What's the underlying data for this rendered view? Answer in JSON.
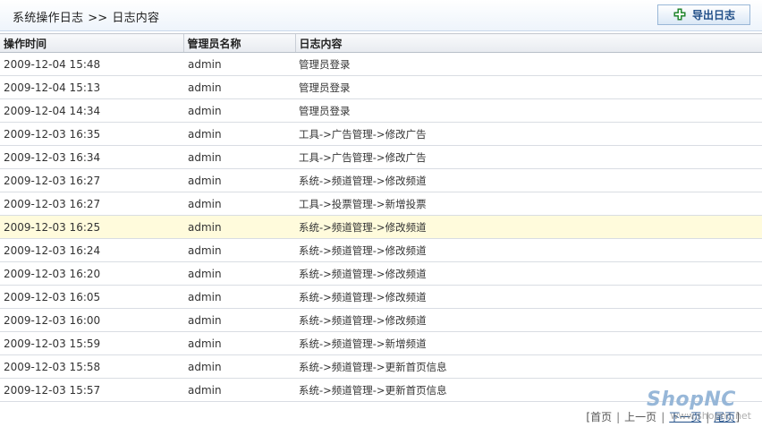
{
  "header": {
    "breadcrumb_section": "系统操作日志",
    "breadcrumb_separator": ">>",
    "breadcrumb_page": "日志内容",
    "export_label": "导出日志",
    "export_icon": "green-puzzle-add-icon"
  },
  "table": {
    "headers": [
      "操作时间",
      "管理员名称",
      "日志内容"
    ],
    "rows": [
      {
        "time": "2009-12-04 15:48",
        "admin": "admin",
        "content": "管理员登录"
      },
      {
        "time": "2009-12-04 15:13",
        "admin": "admin",
        "content": "管理员登录"
      },
      {
        "time": "2009-12-04 14:34",
        "admin": "admin",
        "content": "管理员登录"
      },
      {
        "time": "2009-12-03 16:35",
        "admin": "admin",
        "content": "工具->广告管理->修改广告"
      },
      {
        "time": "2009-12-03 16:34",
        "admin": "admin",
        "content": "工具->广告管理->修改广告"
      },
      {
        "time": "2009-12-03 16:27",
        "admin": "admin",
        "content": "系统->频道管理->修改频道"
      },
      {
        "time": "2009-12-03 16:27",
        "admin": "admin",
        "content": "工具->投票管理->新增投票"
      },
      {
        "time": "2009-12-03 16:25",
        "admin": "admin",
        "content": "系统->频道管理->修改频道"
      },
      {
        "time": "2009-12-03 16:24",
        "admin": "admin",
        "content": "系统->频道管理->修改频道"
      },
      {
        "time": "2009-12-03 16:20",
        "admin": "admin",
        "content": "系统->频道管理->修改频道"
      },
      {
        "time": "2009-12-03 16:05",
        "admin": "admin",
        "content": "系统->频道管理->修改频道"
      },
      {
        "time": "2009-12-03 16:00",
        "admin": "admin",
        "content": "系统->频道管理->修改频道"
      },
      {
        "time": "2009-12-03 15:59",
        "admin": "admin",
        "content": "系统->频道管理->新增频道"
      },
      {
        "time": "2009-12-03 15:58",
        "admin": "admin",
        "content": "系统->频道管理->更新首页信息"
      },
      {
        "time": "2009-12-03 15:57",
        "admin": "admin",
        "content": "系统->频道管理->更新首页信息"
      }
    ],
    "highlight_color": "#fffbdc"
  },
  "pager": {
    "first": "首页",
    "previous": "上一页",
    "next": "下一页",
    "last": "尾页"
  },
  "branding": {
    "logo_text": "ShopNC",
    "watermark_url": "www.shopnc.net"
  }
}
